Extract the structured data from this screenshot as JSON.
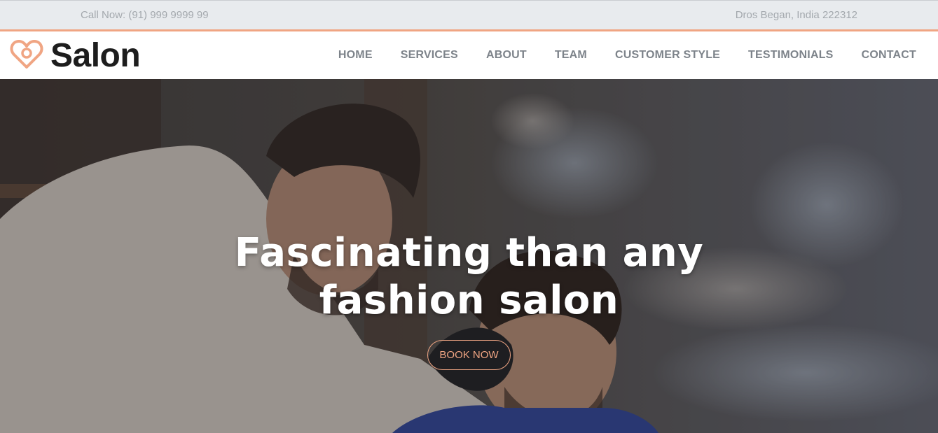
{
  "topbar": {
    "phone": "Call Now: (91) 999 9999 99",
    "address": "Dros Began, India 222312"
  },
  "brand": {
    "name": "Salon",
    "logo_icon": "heart-icon",
    "accent_color": "#f0a583"
  },
  "nav": {
    "items": [
      "HOME",
      "SERVICES",
      "ABOUT",
      "TEAM",
      "CUSTOMER STYLE",
      "TESTIMONIALS",
      "CONTACT"
    ]
  },
  "hero": {
    "headline_line1": "Fascinating than any",
    "headline_line2": "fashion salon",
    "cta_label": "BOOK NOW",
    "background": "barber-cutting-hair-photo"
  }
}
